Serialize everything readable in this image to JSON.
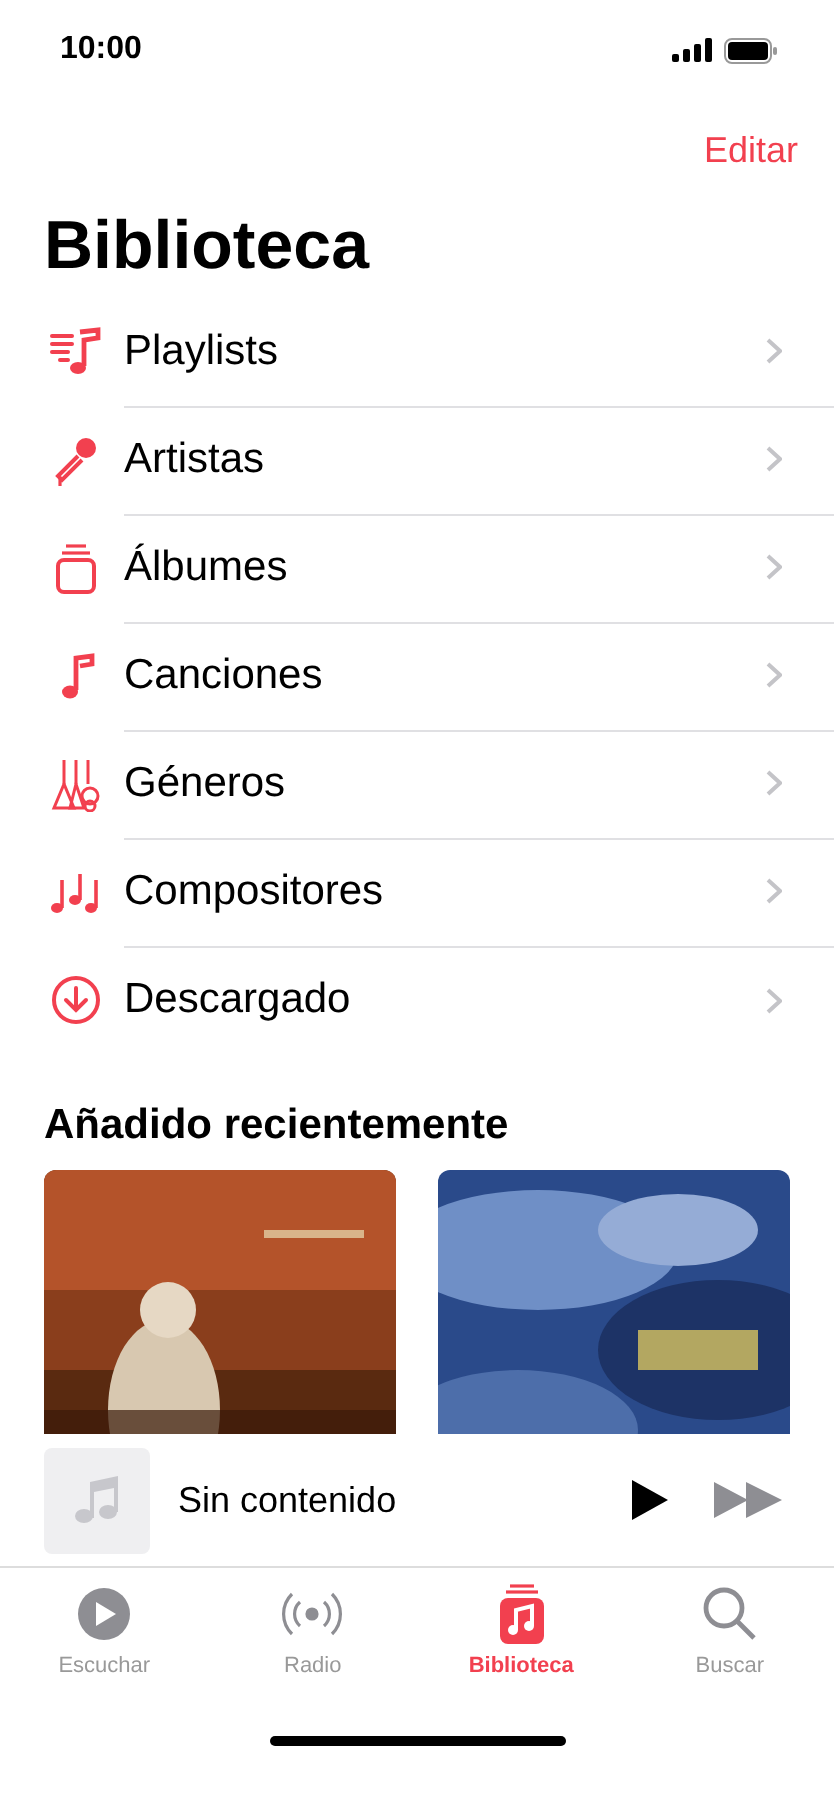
{
  "status_bar": {
    "time": "10:00"
  },
  "nav": {
    "edit": "Editar",
    "title": "Biblioteca"
  },
  "library_items": [
    {
      "label": "Playlists"
    },
    {
      "label": "Artistas"
    },
    {
      "label": "Álbumes"
    },
    {
      "label": "Canciones"
    },
    {
      "label": "Géneros"
    },
    {
      "label": "Compositores"
    },
    {
      "label": "Descargado"
    }
  ],
  "recent": {
    "title": "Añadido recientemente"
  },
  "mini_player": {
    "title": "Sin contenido"
  },
  "tabs": [
    {
      "label": "Escuchar",
      "selected": false
    },
    {
      "label": "Radio",
      "selected": false
    },
    {
      "label": "Biblioteca",
      "selected": true
    },
    {
      "label": "Buscar",
      "selected": false
    }
  ]
}
